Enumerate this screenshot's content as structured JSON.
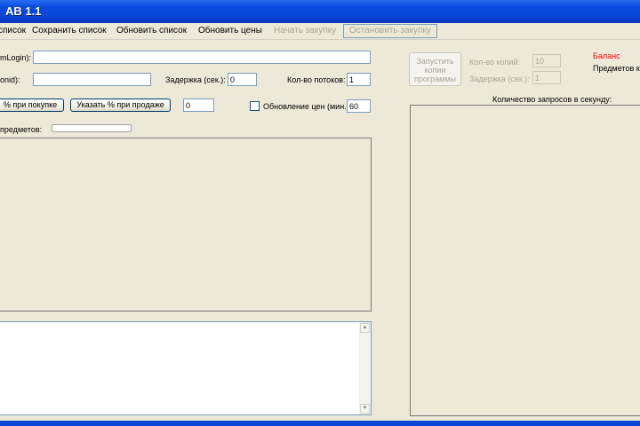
{
  "window": {
    "title": "AB 1.1"
  },
  "menu": {
    "items": [
      {
        "label": "список"
      },
      {
        "label": "Сохранить список"
      },
      {
        "label": "Обновить список"
      },
      {
        "label": "Обновить цены"
      },
      {
        "label": "Начать закупку"
      },
      {
        "label": "Остановить закупку"
      }
    ]
  },
  "form": {
    "login_label": "mLogin):",
    "login_value": "",
    "id_label": "onid):",
    "id_value": "",
    "delay_label": "Задержка (сек.):",
    "delay_value": "0",
    "threads_label": "Кол-во потоков:",
    "threads_value": "1",
    "buy_percent_button": "% при покупке",
    "sell_percent_button": "Указать % при продаже",
    "percent_value": "0",
    "price_update_label": "Обновление цен (мин.):",
    "price_update_value": "60",
    "items_progress_label": "предметов:"
  },
  "copies": {
    "launch_button": "Запустить копии программы",
    "count_label": "Кол-во копий:",
    "count_value": "10",
    "delay_label": "Задержка (сек.):",
    "delay_value": "1"
  },
  "right": {
    "balance_label": "Баланс",
    "items_label": "Предметов ку",
    "rps_label": "Количество запросов в секунду:"
  },
  "colors": {
    "title_blue": "#0a46d6",
    "balance_red": "#ff0000",
    "bg": "#ece9d8"
  }
}
